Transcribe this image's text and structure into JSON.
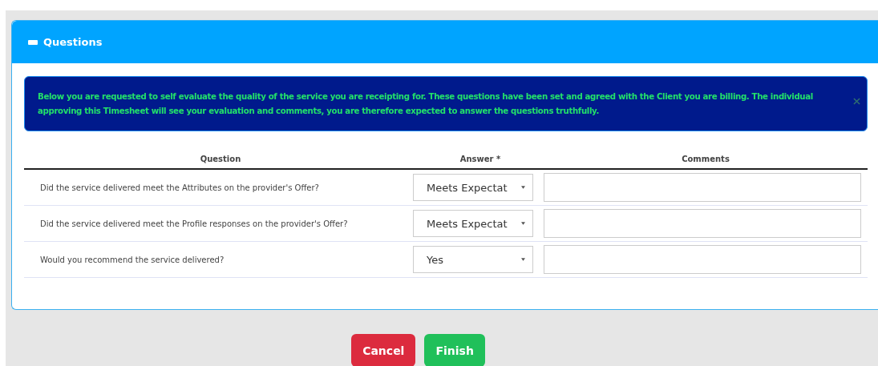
{
  "panel": {
    "title": "Questions",
    "expanded": true
  },
  "notice": "Below you are requested to self evaluate the quality of the service you are receipting for. These questions have been set and agreed with the Client you are billing. The individual approving this Timesheet will see your evaluation and comments, you are therefore expected to answer the questions truthfully.",
  "table": {
    "columns": [
      "Question",
      "Answer *",
      "Comments"
    ],
    "rows": [
      {
        "question": "Did the service delivered meet the Attributes on the provider's Offer?",
        "answer": "Meets Expectat"
      },
      {
        "question": "Did the service delivered meet the Profile responses on the provider's Offer?",
        "answer": "Meets Expectat"
      },
      {
        "question": "Would you recommend the service delivered?",
        "answer": "Yes"
      }
    ]
  },
  "buttons": [
    {
      "label": "Cancel",
      "kind": "danger"
    },
    {
      "label": "Finish",
      "kind": "success"
    }
  ]
}
